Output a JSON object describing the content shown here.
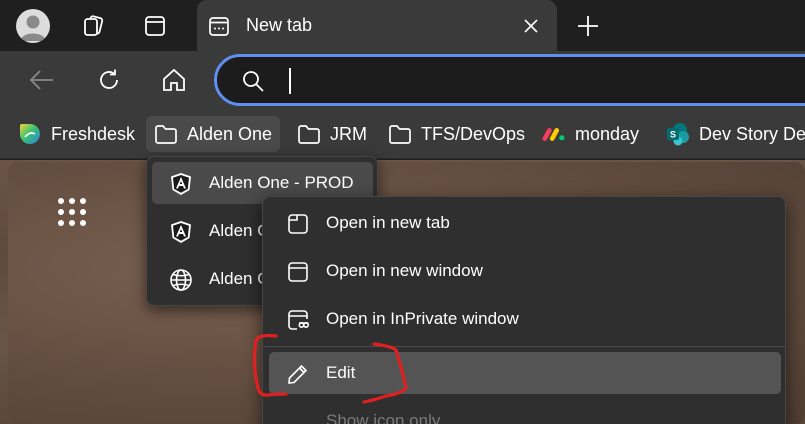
{
  "tabstrip": {
    "profile_icon": "person-avatar-icon",
    "workspaces_icon": "workspaces-icon",
    "tab_actions_icon": "tab-actions-icon",
    "tab": {
      "title": "New tab",
      "icon": "new-tab-page-icon",
      "close_icon": "close-icon"
    },
    "new_tab_icon": "plus-icon"
  },
  "toolbar": {
    "back_icon": "arrow-left-icon",
    "refresh_icon": "refresh-icon",
    "home_icon": "home-icon",
    "address": {
      "value": "",
      "placeholder": "",
      "search_icon": "search-icon"
    },
    "accent_color": "#5d8ff0"
  },
  "favorites": [
    {
      "label": "Freshdesk",
      "icon": "freshdesk-logo-icon"
    },
    {
      "label": "Alden One",
      "icon": "folder-icon",
      "active": true
    },
    {
      "label": "JRM",
      "icon": "folder-icon"
    },
    {
      "label": "TFS/DevOps",
      "icon": "folder-icon"
    },
    {
      "label": "monday",
      "icon": "monday-logo-icon"
    },
    {
      "label": "Dev Story Der",
      "icon": "sharepoint-logo-icon"
    }
  ],
  "folder_menu": {
    "items": [
      {
        "label": "Alden One - PROD",
        "icon": "angular-icon"
      },
      {
        "label": "Alden O",
        "icon": "angular-icon"
      },
      {
        "label": "Alden O",
        "icon": "globe-icon"
      }
    ]
  },
  "context_menu": {
    "items": [
      {
        "label": "Open in new tab",
        "icon": "new-tab-icon"
      },
      {
        "label": "Open in new window",
        "icon": "new-window-icon"
      },
      {
        "label": "Open in InPrivate window",
        "icon": "inprivate-window-icon"
      },
      {
        "label": "Edit",
        "icon": "pencil-icon"
      },
      {
        "label": "Show icon only",
        "icon": ""
      }
    ]
  },
  "page": {
    "apps_icon": "app-launcher-icon"
  },
  "annotation_color": "#e02020"
}
